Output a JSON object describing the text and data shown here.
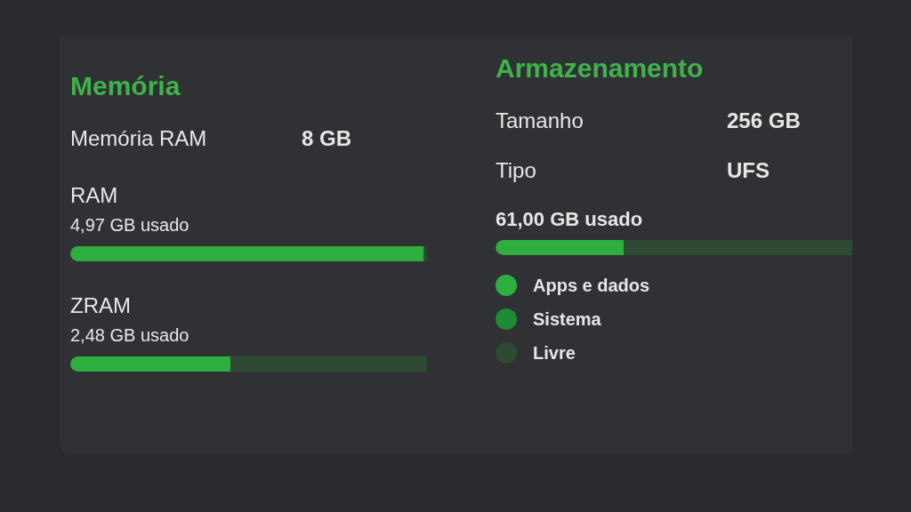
{
  "memory": {
    "title": "Memória",
    "specs": [
      {
        "label": "Memória RAM",
        "value": "8 GB"
      }
    ],
    "usages": [
      {
        "name": "RAM",
        "reading": "4,97 GB usado",
        "level": 0.99
      },
      {
        "name": "ZRAM",
        "reading": "2,48 GB usado",
        "level": 0.45
      }
    ]
  },
  "storage": {
    "title": "Armazenamento",
    "specs": [
      {
        "label": "Tamanho",
        "value": "256 GB"
      },
      {
        "label": "Tipo",
        "value": "UFS"
      }
    ],
    "reading": "61,00 GB usado",
    "level": 0.36,
    "legend": [
      {
        "label": "Apps e dados",
        "color": "#2eae3f"
      },
      {
        "label": "Sistema",
        "color": "#1e8a34"
      },
      {
        "label": "Livre",
        "color": "#2f4a33"
      }
    ]
  }
}
